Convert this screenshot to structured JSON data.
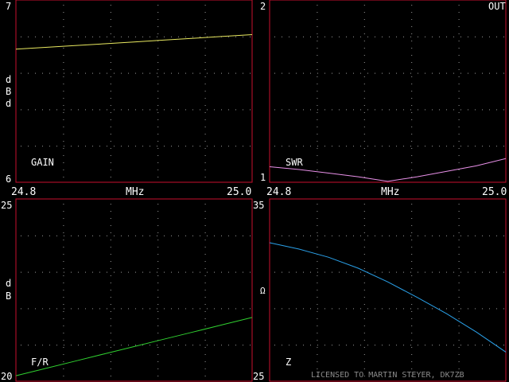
{
  "header": {
    "mode_label": "OUT"
  },
  "license_text": "LICENSED TO MARTIN STEYER, DK7ZB",
  "colors": {
    "frame": "#c8102e",
    "grid": "#9a9a9a",
    "gain_line": "#e8e860",
    "swr_line": "#e890e8",
    "fr_line": "#30d030",
    "z_line": "#2aa0e8"
  },
  "chart_data": [
    {
      "type": "line",
      "id": "gain",
      "label": "GAIN",
      "ylim": [
        6,
        7
      ],
      "ytick_top": "7",
      "ytick_bottom": "6",
      "ylabel_chars": [
        "d",
        "B",
        "d"
      ],
      "x": [
        24.8,
        25.0
      ],
      "xtick_left": "24.8",
      "xtick_right": "25.0",
      "xlabel": "MHz",
      "values": [
        6.73,
        6.74,
        6.75,
        6.76,
        6.77,
        6.78,
        6.79,
        6.8,
        6.81
      ],
      "grid": true
    },
    {
      "type": "line",
      "id": "swr",
      "label": "SWR",
      "ylim": [
        1,
        2
      ],
      "ytick_top": "2",
      "ytick_bottom": "1",
      "ylabel_chars": [],
      "x": [
        24.8,
        25.0
      ],
      "xtick_left": "24.8",
      "xtick_right": "25.0",
      "xlabel": "MHz",
      "values": [
        1.085,
        1.07,
        1.05,
        1.03,
        1.005,
        1.03,
        1.06,
        1.09,
        1.13
      ],
      "grid": true
    },
    {
      "type": "line",
      "id": "fr",
      "label": "F/R",
      "ylim": [
        20,
        25
      ],
      "ytick_top": "25",
      "ytick_bottom": "20",
      "ylabel_chars": [
        "d",
        "B"
      ],
      "x": [
        24.8,
        25.0
      ],
      "xtick_left": "",
      "xtick_right": "",
      "xlabel": "",
      "values": [
        20.15,
        20.35,
        20.55,
        20.75,
        20.95,
        21.15,
        21.35,
        21.55,
        21.75
      ],
      "grid": true
    },
    {
      "type": "line",
      "id": "z",
      "label": "Z",
      "ylim": [
        25,
        35
      ],
      "ytick_top": "35",
      "ytick_bottom": "25",
      "ylabel_chars": [
        "Ω"
      ],
      "x": [
        24.8,
        25.0
      ],
      "xtick_left": "",
      "xtick_right": "",
      "xlabel": "",
      "values": [
        32.6,
        32.25,
        31.8,
        31.2,
        30.45,
        29.6,
        28.7,
        27.7,
        26.6
      ],
      "grid": true
    }
  ]
}
